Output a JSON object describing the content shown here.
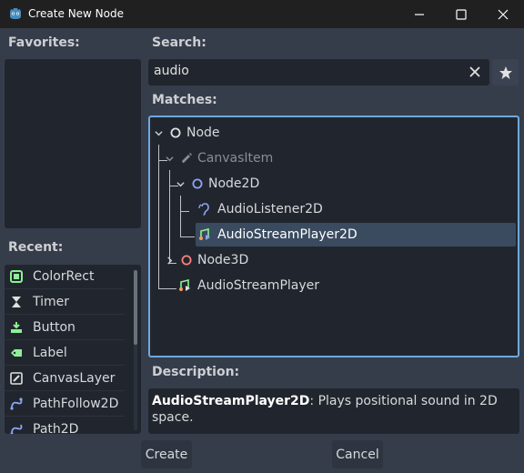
{
  "window": {
    "title": "Create New Node",
    "minimize_icon": "minimize-icon",
    "maximize_icon": "maximize-icon",
    "close_icon": "close-icon"
  },
  "favorites": {
    "label": "Favorites:"
  },
  "search": {
    "label": "Search:",
    "value": "audio",
    "clear_icon": "clear-icon",
    "favorite_icon": "star-icon"
  },
  "matches": {
    "label": "Matches:",
    "tree": [
      {
        "label": "Node",
        "icon": "node-icon",
        "expanded": true
      },
      {
        "label": "CanvasItem",
        "icon": "canvasitem-icon",
        "expanded": true,
        "disabled": true
      },
      {
        "label": "Node2D",
        "icon": "node2d-icon",
        "expanded": true
      },
      {
        "label": "AudioListener2D",
        "icon": "audiolistener2d-icon"
      },
      {
        "label": "AudioStreamPlayer2D",
        "icon": "audiostreamplayer2d-icon",
        "selected": true
      },
      {
        "label": "Node3D",
        "icon": "node3d-icon",
        "expanded": false
      },
      {
        "label": "AudioStreamPlayer",
        "icon": "audiostreamplayer-icon"
      }
    ]
  },
  "recent": {
    "label": "Recent:",
    "items": [
      {
        "label": "ColorRect",
        "icon": "colorrect-icon"
      },
      {
        "label": "Timer",
        "icon": "timer-icon"
      },
      {
        "label": "Button",
        "icon": "button-icon"
      },
      {
        "label": "Label",
        "icon": "label-icon"
      },
      {
        "label": "CanvasLayer",
        "icon": "canvaslayer-icon"
      },
      {
        "label": "PathFollow2D",
        "icon": "pathfollow2d-icon"
      },
      {
        "label": "Path2D",
        "icon": "path2d-icon"
      }
    ]
  },
  "description": {
    "label": "Description:",
    "node_name": "AudioStreamPlayer2D",
    "text": ": Plays positional sound in 2D space."
  },
  "buttons": {
    "create": "Create",
    "cancel": "Cancel"
  },
  "colors": {
    "background": "#363d4a",
    "panel": "#21262e",
    "accent": "#6fa8dc",
    "selection": "#3a4b60",
    "node2d_blue": "#8da5f3",
    "node3d_red": "#fc7f7f",
    "control_green": "#8eef97"
  }
}
